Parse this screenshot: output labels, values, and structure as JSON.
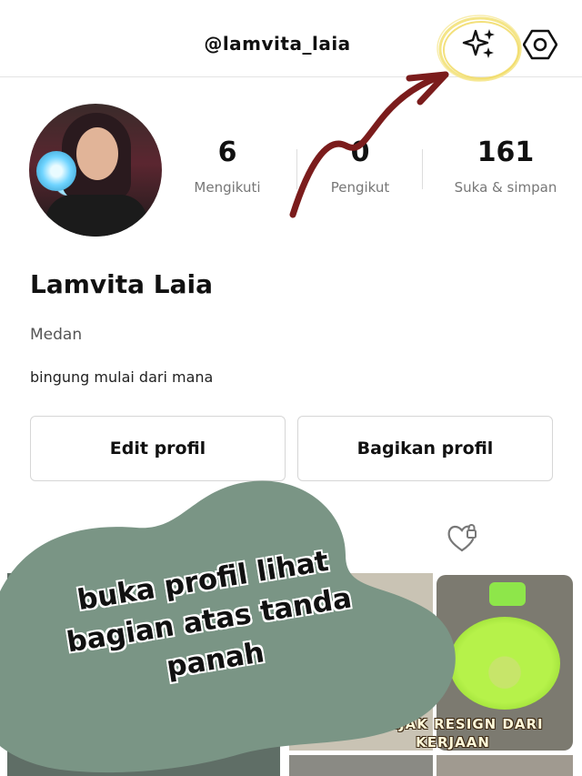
{
  "header": {
    "username": "@lamvita_laia",
    "sparkle_icon": "sparkles-icon",
    "settings_icon": "hexagon-settings-icon"
  },
  "profile": {
    "display_name": "Lamvita Laia",
    "location": "Medan",
    "bio": "bingung mulai dari mana"
  },
  "stats": [
    {
      "value": "6",
      "label": "Mengikuti"
    },
    {
      "value": "0",
      "label": "Pengikut"
    },
    {
      "value": "161",
      "label": "Suka & simpan"
    }
  ],
  "buttons": {
    "edit_profile": "Edit profil",
    "share_profile": "Bagikan profil"
  },
  "overlay": {
    "text": "buka profil lihat bagian atas tanda panah",
    "blob_color": "#7a9585",
    "arrow_color": "#7b1c1c",
    "highlight_color": "#f3e27a"
  },
  "thumbnails": {
    "right_caption": "MENJAK RESIGN DARI KERJAAN"
  }
}
